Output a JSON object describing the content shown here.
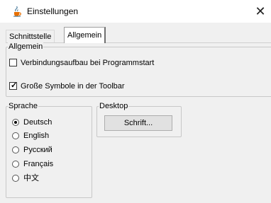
{
  "window": {
    "title": "Einstellungen",
    "icon": "java-cup-icon",
    "close_glyph": "✕"
  },
  "tabs": [
    {
      "label": "Schnittstelle",
      "selected": false
    },
    {
      "label": "Allgemein",
      "selected": true
    }
  ],
  "general_group": {
    "label": "Allgemein",
    "options": [
      {
        "label": "Verbindungsaufbau bei Programmstart",
        "checked": false
      },
      {
        "label": "Große Symbole in der Toolbar",
        "checked": true
      }
    ]
  },
  "language_group": {
    "label": "Sprache",
    "options": [
      {
        "label": "Deutsch",
        "selected": true
      },
      {
        "label": "English",
        "selected": false
      },
      {
        "label": "Русский",
        "selected": false
      },
      {
        "label": "Français",
        "selected": false
      },
      {
        "label": "中文",
        "selected": false
      }
    ]
  },
  "desktop_group": {
    "label": "Desktop",
    "font_button": "Schrift..."
  },
  "colors": {
    "client_bg": "#f0f0f0",
    "titlebar_bg": "#ffffff",
    "group_border": "#c8c8c8"
  }
}
